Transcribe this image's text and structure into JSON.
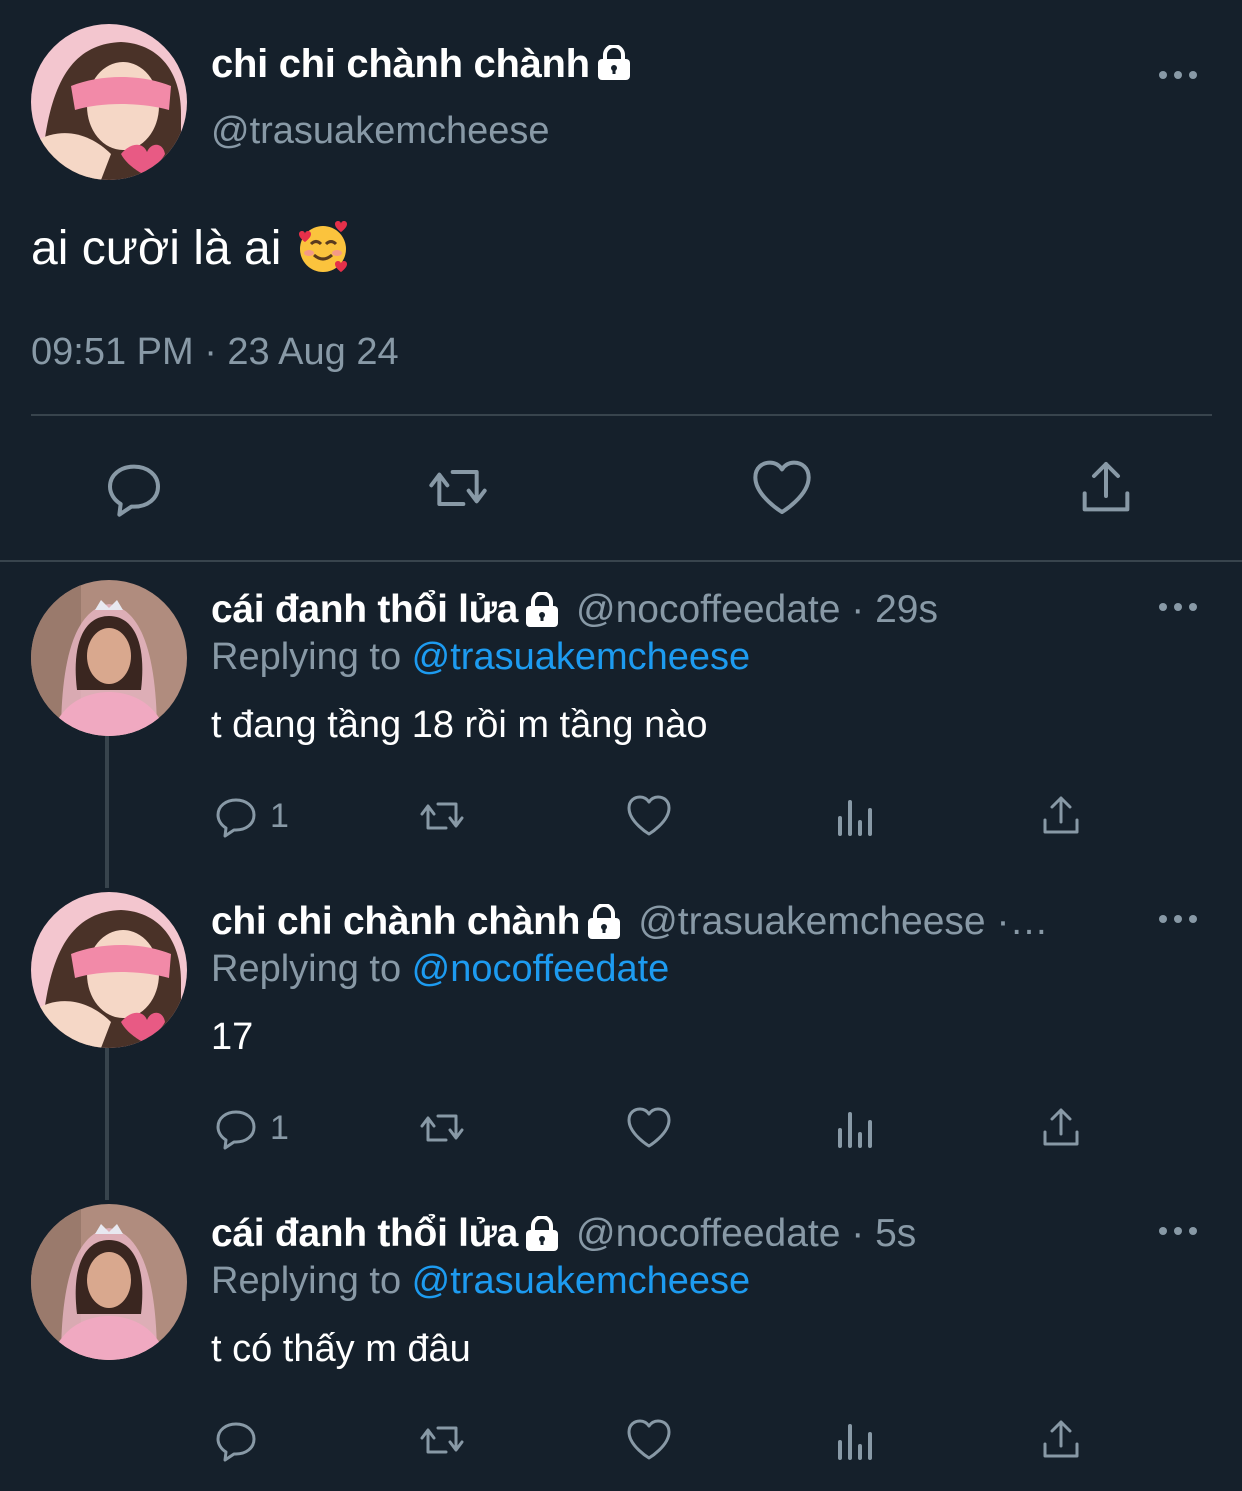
{
  "main_tweet": {
    "display_name": "chi chi chành chành",
    "handle": "@trasuakemcheese",
    "text": "ai cười là ai",
    "emoji": "🥰",
    "timestamp": "09:51 PM · 23 Aug 24"
  },
  "replies": [
    {
      "display_name": "cái đanh thổi lửa",
      "handle": "@nocoffeedate",
      "separator": " · ",
      "time": "29s",
      "replying_label": "Replying to ",
      "replying_to": "@trasuakemcheese",
      "text": "t đang tầng 18 rồi m tầng nào",
      "reply_count": "1"
    },
    {
      "display_name": "chi chi chành chành",
      "handle": "@trasuakemcheese",
      "separator": " ·",
      "time": "…",
      "replying_label": "Replying to ",
      "replying_to": "@nocoffeedate",
      "text": "17",
      "reply_count": "1"
    },
    {
      "display_name": "cái đanh thổi lửa",
      "handle": "@nocoffeedate",
      "separator": " · ",
      "time": "5s",
      "replying_label": "Replying to ",
      "replying_to": "@trasuakemcheese",
      "text": "t có thấy m đâu",
      "reply_count": ""
    }
  ],
  "colors": {
    "background": "#15202b",
    "secondary_text": "#8899a6",
    "accent": "#1d9bf0",
    "divider": "#38444d"
  },
  "icons": [
    "lock-icon",
    "more-icon",
    "reply-icon",
    "retweet-icon",
    "like-icon",
    "share-icon",
    "analytics-icon"
  ]
}
